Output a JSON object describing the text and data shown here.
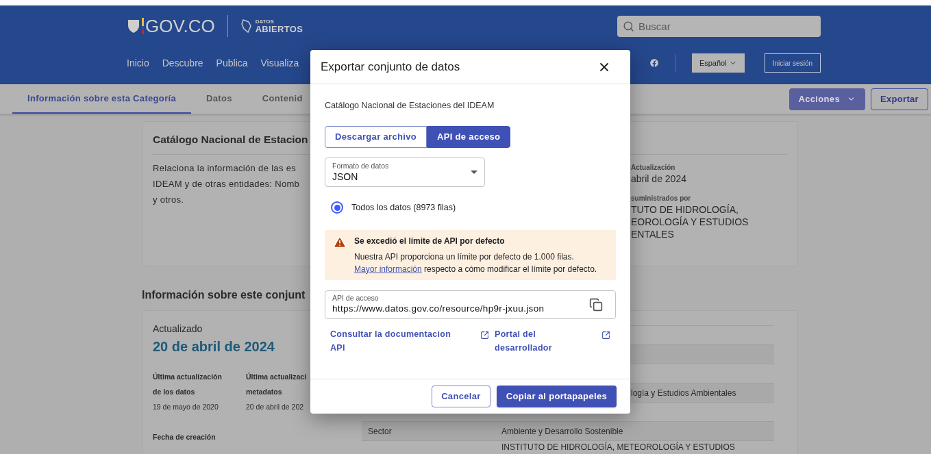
{
  "header": {
    "logo_text": "GOV.CO",
    "brand_small": "DATOS",
    "brand_big": "ABIERTOS",
    "search": {
      "placeholder": "Buscar"
    },
    "nav": [
      "Inicio",
      "Descubre",
      "Publica",
      "Visualiza"
    ],
    "language": "Español",
    "login": "Iniciar sesión"
  },
  "tabs": [
    {
      "label": "Información sobre esta Categoría",
      "selected": true
    },
    {
      "label": "Datos",
      "selected": false
    },
    {
      "label": "Contenid",
      "selected": false
    }
  ],
  "actions": {
    "menu": "Acciones",
    "export": "Exportar"
  },
  "summary_card": {
    "title": "Catálogo Nacional de Estacion",
    "description_lines": [
      "Relaciona la información de las es",
      "IDEAM y de otras entidades: Nomb",
      "y otros."
    ],
    "fields": [
      {
        "label": "Actualización",
        "value_lines": [
          "abril de 2024"
        ]
      },
      {
        "label": "suministrados por",
        "value_lines": [
          "TUTO DE HIDROLOGÍA,",
          "EOROLOGÍA Y ESTUDIOS",
          "ENTALES"
        ]
      }
    ]
  },
  "section_title": "Información sobre este conjunt",
  "info_card": {
    "updated_label": "Actualizado",
    "updated_date": "20 de abril de 2024",
    "dates": [
      {
        "label_lines": [
          "Última actualización",
          "de los datos"
        ],
        "value": "19 de mayo de 2020"
      },
      {
        "label_lines": [
          "Última actualizaci",
          "metadatos"
        ],
        "value": "20 de abril de 202"
      }
    ],
    "created_label": "Fecha de creación",
    "table_rows": [
      {},
      {},
      {},
      {
        "kind": "clipped",
        "value": "logía y Estudios Ambientales"
      },
      {},
      {
        "kind": "full",
        "label": "Sector",
        "value": "Ambiente y Desarrollo Sostenible"
      },
      {
        "kind": "full",
        "value": "INSTITUTO DE HIDROLOGÍA, METEOROLOGÍA Y ESTUDIOS"
      }
    ]
  },
  "dialog": {
    "title": "Exportar conjunto de datos",
    "subtitle": "Catálogo Nacional de Estaciones del IDEAM",
    "modes": [
      {
        "label": "Descargar archivo",
        "selected": false
      },
      {
        "label": "API de acceso",
        "selected": true
      }
    ],
    "format": {
      "label": "Formato de datos",
      "value": "JSON"
    },
    "rows_option": {
      "label": "Todos los datos (8973 filas)",
      "selected": true
    },
    "alert": {
      "title": "Se excedió el límite de API por defecto",
      "line_1": "Nuestra API proporciona un límite por defecto de 1.000 filas.",
      "link": "Mayor información",
      "rest": "respecto a cómo modificar el límite por defecto."
    },
    "api_field": {
      "label": "API de acceso",
      "value": "https://www.datos.gov.co/resource/hp9r-jxuu.json"
    },
    "links": [
      "Consultar la documentacion API",
      "Portal del desarrollador"
    ],
    "cancel": "Cancelar",
    "confirm": "Copiar al portapapeles"
  }
}
